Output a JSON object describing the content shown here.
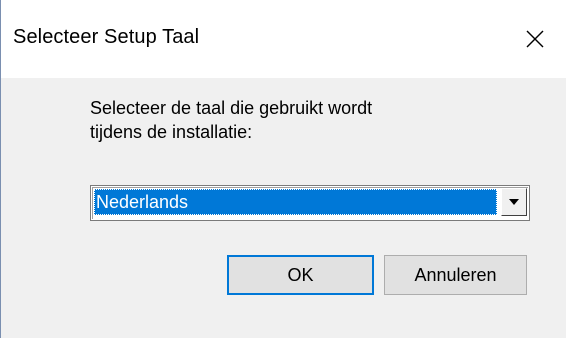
{
  "window": {
    "title": "Selecteer Setup Taal",
    "close_label": "Close"
  },
  "dialog": {
    "prompt_line1": "Selecteer de taal die gebruikt wordt",
    "prompt_line2": "tijdens de installatie:"
  },
  "language_select": {
    "selected": "Nederlands"
  },
  "buttons": {
    "ok_label": "OK",
    "cancel_label": "Annuleren"
  },
  "colors": {
    "selection": "#0078d7",
    "default_button_border": "#0078d7",
    "dialog_background": "#f0f0f0",
    "title_background": "#ffffff"
  },
  "icons": {
    "close": "close-icon",
    "dropdown": "chevron-down-icon"
  }
}
